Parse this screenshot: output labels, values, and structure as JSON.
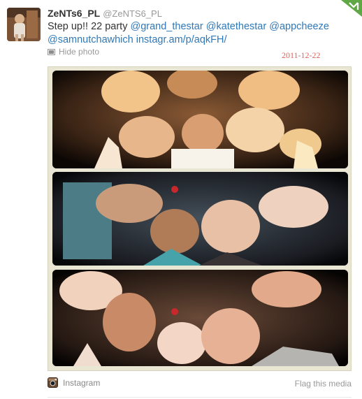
{
  "tweet": {
    "fullname": "ZeNTs6_PL",
    "username": "@ZeNTS6_PL",
    "text_prefix": "Step up!! 22 party ",
    "mentions": [
      "@grand_thestar",
      "@katethestar",
      "@appcheeze",
      "@samnutchawhich"
    ],
    "link": "instagr.am/p/aqkFH/",
    "hide_photo_label": "Hide photo",
    "date_stamp": "2011-12-22"
  },
  "media": {
    "source_label": "Instagram",
    "flag_label": "Flag this media"
  },
  "icons": {
    "photo": "photo-icon",
    "instagram": "instagram-icon",
    "corner": "corner-fold-icon"
  },
  "colors": {
    "link": "#2f78b9",
    "muted": "#999999",
    "stamp": "#e0635c",
    "frame": "#e9e7d3"
  }
}
